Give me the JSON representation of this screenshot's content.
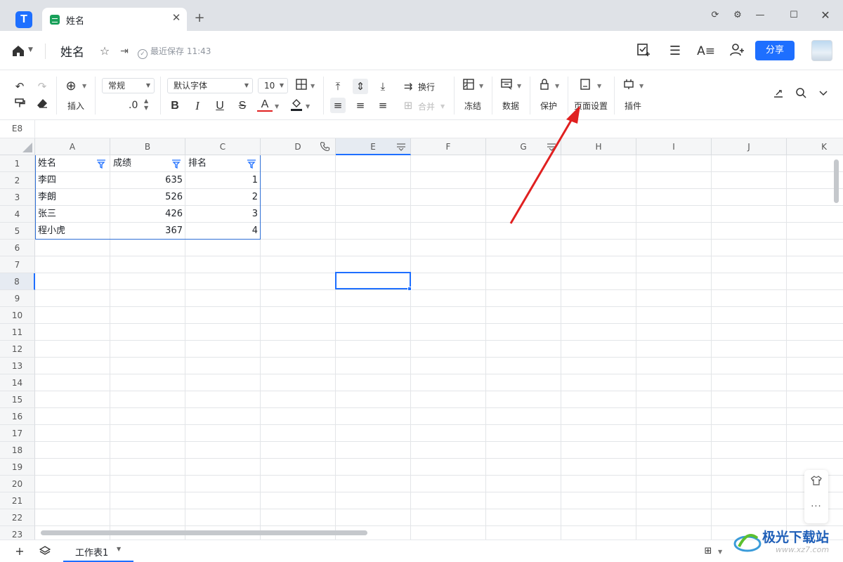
{
  "tab": {
    "title": "姓名"
  },
  "header": {
    "doc_title": "姓名",
    "save_status": "最近保存 11:43",
    "share_label": "分享"
  },
  "toolbar": {
    "insert_label": "插入",
    "number_format": "常规",
    "decimal": ".0",
    "font_family": "默认字体",
    "font_size": "10",
    "wrap_label": "换行",
    "merge_label": "合并",
    "freeze_label": "冻结",
    "data_label": "数据",
    "protect_label": "保护",
    "page_setup_label": "页面设置",
    "plugins_label": "插件",
    "bold": "B",
    "italic": "I",
    "underline": "U",
    "strike": "S",
    "font_color": "A"
  },
  "formula_bar": {
    "cell_ref": "E8"
  },
  "grid": {
    "columns": [
      "A",
      "B",
      "C",
      "D",
      "E",
      "F",
      "G",
      "H",
      "I",
      "J",
      "K"
    ],
    "selected_column": "E",
    "selected_row": "8",
    "rows": [
      "1",
      "2",
      "3",
      "4",
      "5",
      "6",
      "7",
      "8",
      "9",
      "10",
      "11",
      "12",
      "13",
      "14",
      "15",
      "16",
      "17",
      "18",
      "19",
      "20",
      "21",
      "22",
      "23"
    ],
    "table": {
      "headers": [
        "姓名",
        "成绩",
        "排名"
      ],
      "data": [
        [
          "李四",
          "635",
          "1"
        ],
        [
          "李朗",
          "526",
          "2"
        ],
        [
          "张三",
          "426",
          "3"
        ],
        [
          "程小虎",
          "367",
          "4"
        ]
      ]
    }
  },
  "sheets": {
    "active": "工作表1"
  },
  "watermark": {
    "brand": "极光下载站",
    "url": "www.xz7.com"
  },
  "colors": {
    "accent": "#1e6fff",
    "annotation_arrow": "#e02020",
    "sheet_icon": "#19a05a"
  }
}
